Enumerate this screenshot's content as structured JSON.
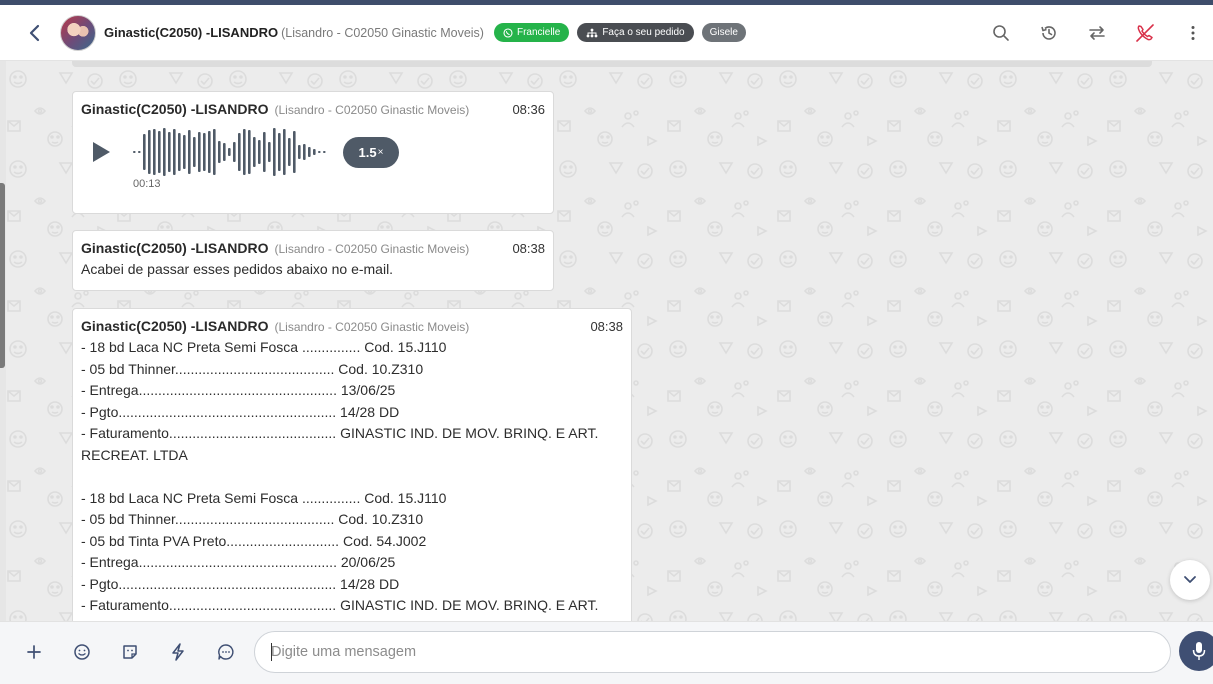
{
  "header": {
    "contact_name": "Ginastic(C2050) -LISANDRO",
    "contact_sub": "(Lisandro - C02050 Ginastic Moveis)",
    "tags": [
      {
        "label": "Francielle",
        "icon": "whatsapp-icon"
      },
      {
        "label": "Faça o seu pedido",
        "icon": "sitemap-icon"
      },
      {
        "label": "Gisele"
      }
    ],
    "actions": [
      "search-icon",
      "history-icon",
      "transfer-icon",
      "end-call-icon",
      "more-vertical-icon"
    ]
  },
  "messages": [
    {
      "type": "audio",
      "sender": "Ginastic(C2050) -LISANDRO",
      "sender_sub": "(Lisandro - C02050 Ginastic Moveis)",
      "time": "08:36",
      "duration": "00:13",
      "speed": "1.5",
      "speed_suffix": "×"
    },
    {
      "type": "text",
      "sender": "Ginastic(C2050) -LISANDRO",
      "sender_sub": "(Lisandro - C02050 Ginastic Moveis)",
      "time": "08:38",
      "text": "Acabei de passar esses pedidos abaixo no e-mail."
    },
    {
      "type": "text",
      "sender": "Ginastic(C2050) -LISANDRO",
      "sender_sub": "(Lisandro - C02050 Ginastic Moveis)",
      "time": "08:38",
      "text": "- 18 bd Laca NC Preta Semi Fosca ............... Cod. 15.J110\n- 05 bd Thinner......................................... Cod. 10.Z310\n- Entrega................................................... 13/06/25\n- Pgto........................................................ 14/28 DD\n- Faturamento........................................... GINASTIC IND. DE MOV. BRINQ. E ART. RECREAT. LTDA\n\n- 18 bd Laca NC Preta Semi Fosca ............... Cod. 15.J110\n- 05 bd Thinner......................................... Cod. 10.Z310\n- 05 bd Tinta PVA Preto............................. Cod. 54.J002\n- Entrega................................................... 20/06/25\n- Pgto........................................................ 14/28 DD\n- Faturamento........................................... GINASTIC IND. DE MOV. BRINQ. E ART."
    }
  ],
  "composer": {
    "placeholder": "Digite uma mensagem",
    "tools": [
      "plus-icon",
      "emoji-icon",
      "sticker-icon",
      "lightning-icon",
      "quick-reply-icon"
    ]
  },
  "colors": {
    "accent": "#3f4f73",
    "tag_green": "#25b34a",
    "tag_dark": "#4a4d52",
    "tag_grey": "#6e7378",
    "end_call": "#d9314a"
  }
}
